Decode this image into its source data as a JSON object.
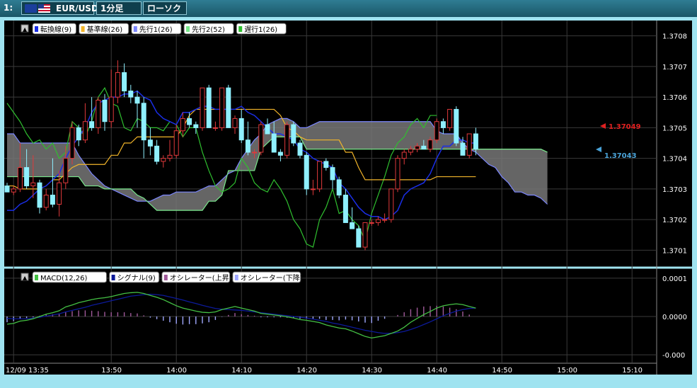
{
  "toolbar": {
    "pane_number": "1:",
    "pair": "EUR/USD",
    "timeframe": "1分足",
    "chart_type": "ローソク"
  },
  "colors": {
    "bg": "#000000",
    "grid": "#3a3a3a",
    "up_body": "#000000",
    "up_border": "#e0393b",
    "down_body": "#8ff0ff",
    "kumo": "#777777",
    "tenkan": "#1a2ee6",
    "kijun": "#f2b52a",
    "senkou1": "#7b86ff",
    "senkou2": "#79e88c",
    "chikou": "#2fbf2f",
    "macd": "#44c044",
    "signal": "#0c1a9a",
    "osc_up": "#a05a9a",
    "osc_down": "#a0a8ff"
  },
  "chart_data": [
    {
      "type": "candlestick",
      "legend": [
        "転換線(9)",
        "基準線(26)",
        "先行1(26)",
        "先行2(52)",
        "遅行1(26)"
      ],
      "y_ticks": [
        "1.3708",
        "1.3707",
        "1.3706",
        "1.3705",
        "1.3704",
        "1.3703",
        "1.3702",
        "1.3701"
      ],
      "ylim": [
        1.37005,
        1.37085
      ],
      "x_ticks": [
        "12/09 13:35",
        "13:50",
        "14:00",
        "14:10",
        "14:20",
        "14:30",
        "14:40",
        "14:50",
        "15:00",
        "15:10"
      ],
      "price_labels": [
        "1.37049",
        "1.37043"
      ],
      "candles": [
        [
          1.37031,
          1.37032,
          1.37029,
          1.37029
        ],
        [
          1.37029,
          1.37031,
          1.37028,
          1.3703
        ],
        [
          1.3703,
          1.37045,
          1.37029,
          1.37037
        ],
        [
          1.37037,
          1.37043,
          1.3703,
          1.37031
        ],
        [
          1.37031,
          1.37041,
          1.37027,
          1.37032
        ],
        [
          1.37032,
          1.37033,
          1.37022,
          1.37024
        ],
        [
          1.37024,
          1.3703,
          1.37023,
          1.37028
        ],
        [
          1.37028,
          1.3704,
          1.37024,
          1.37025
        ],
        [
          1.37025,
          1.37036,
          1.37021,
          1.37032
        ],
        [
          1.37032,
          1.37044,
          1.3703,
          1.3704
        ],
        [
          1.3704,
          1.37052,
          1.37038,
          1.3705
        ],
        [
          1.3705,
          1.37051,
          1.37044,
          1.37046
        ],
        [
          1.37046,
          1.37058,
          1.37045,
          1.37052
        ],
        [
          1.37052,
          1.3706,
          1.37049,
          1.3705
        ],
        [
          1.3705,
          1.3706,
          1.37048,
          1.37059
        ],
        [
          1.37059,
          1.37061,
          1.37049,
          1.37052
        ],
        [
          1.37052,
          1.37069,
          1.3705,
          1.3706
        ],
        [
          1.3706,
          1.37072,
          1.37058,
          1.37068
        ],
        [
          1.37068,
          1.37071,
          1.3706,
          1.37062
        ],
        [
          1.37062,
          1.37064,
          1.37058,
          1.3706
        ],
        [
          1.3706,
          1.37062,
          1.3705,
          1.37058
        ],
        [
          1.37058,
          1.3706,
          1.3704,
          1.37046
        ],
        [
          1.37046,
          1.3705,
          1.37041,
          1.37044
        ],
        [
          1.37044,
          1.37046,
          1.37038,
          1.37039
        ],
        [
          1.37039,
          1.37041,
          1.37037,
          1.3704
        ],
        [
          1.3704,
          1.37046,
          1.37039,
          1.37041
        ],
        [
          1.37041,
          1.37051,
          1.3704,
          1.37049
        ],
        [
          1.37049,
          1.37055,
          1.37047,
          1.37053
        ],
        [
          1.37053,
          1.37055,
          1.3705,
          1.37051
        ],
        [
          1.37051,
          1.37052,
          1.37048,
          1.3705
        ],
        [
          1.3705,
          1.37063,
          1.37049,
          1.37063
        ],
        [
          1.37063,
          1.37064,
          1.3705,
          1.3705
        ],
        [
          1.3705,
          1.37052,
          1.37049,
          1.3705
        ],
        [
          1.3705,
          1.37063,
          1.37049,
          1.37063
        ],
        [
          1.37063,
          1.37064,
          1.3705,
          1.3705
        ],
        [
          1.3705,
          1.37054,
          1.37048,
          1.37053
        ],
        [
          1.37053,
          1.37056,
          1.37045,
          1.37046
        ],
        [
          1.37046,
          1.37052,
          1.37041,
          1.37042
        ],
        [
          1.37042,
          1.37043,
          1.3704,
          1.37042
        ],
        [
          1.37042,
          1.37052,
          1.37041,
          1.37051
        ],
        [
          1.37051,
          1.37053,
          1.37048,
          1.37048
        ],
        [
          1.37048,
          1.37052,
          1.37043,
          1.37042
        ],
        [
          1.37042,
          1.37043,
          1.37039,
          1.37041
        ],
        [
          1.37041,
          1.37052,
          1.3704,
          1.37051
        ],
        [
          1.37051,
          1.37052,
          1.37044,
          1.37045
        ],
        [
          1.37045,
          1.37046,
          1.3704,
          1.37041
        ],
        [
          1.37041,
          1.37042,
          1.37028,
          1.3703
        ],
        [
          1.3703,
          1.37033,
          1.37028,
          1.3703
        ],
        [
          1.3703,
          1.37039,
          1.37029,
          1.37039
        ],
        [
          1.37039,
          1.3704,
          1.37036,
          1.37037
        ],
        [
          1.37037,
          1.37038,
          1.3703,
          1.37033
        ],
        [
          1.37033,
          1.37034,
          1.37027,
          1.37028
        ],
        [
          1.37028,
          1.3703,
          1.37019,
          1.37019
        ],
        [
          1.37019,
          1.37024,
          1.37017,
          1.37017
        ],
        [
          1.37017,
          1.37018,
          1.37011,
          1.37011
        ],
        [
          1.37011,
          1.37019,
          1.3701,
          1.37019
        ],
        [
          1.37019,
          1.3702,
          1.37018,
          1.37019
        ],
        [
          1.37019,
          1.37021,
          1.37018,
          1.3702
        ],
        [
          1.3702,
          1.37022,
          1.37019,
          1.3702
        ],
        [
          1.3702,
          1.3703,
          1.37019,
          1.3703
        ],
        [
          1.3703,
          1.37041,
          1.37029,
          1.3704
        ],
        [
          1.3704,
          1.37043,
          1.37038,
          1.37042
        ],
        [
          1.37042,
          1.37044,
          1.37041,
          1.37043
        ],
        [
          1.37043,
          1.37045,
          1.37042,
          1.37044
        ],
        [
          1.37044,
          1.37046,
          1.37043,
          1.37043
        ],
        [
          1.37043,
          1.37047,
          1.37042,
          1.37046
        ],
        [
          1.37046,
          1.37053,
          1.37045,
          1.37052
        ],
        [
          1.37052,
          1.37053,
          1.37048,
          1.3705
        ],
        [
          1.3705,
          1.37056,
          1.37049,
          1.37056
        ],
        [
          1.37056,
          1.37057,
          1.37044,
          1.37045
        ],
        [
          1.37045,
          1.37047,
          1.37041,
          1.37041
        ],
        [
          1.37041,
          1.37048,
          1.3704,
          1.37048
        ],
        [
          1.37048,
          1.3705,
          1.37041,
          1.37043
        ]
      ],
      "tenkan": [
        1.37023,
        1.37023,
        1.37025,
        1.37026,
        1.37028,
        1.3703,
        1.37031,
        1.37033,
        1.37035,
        1.3704,
        1.37044,
        1.37047,
        1.3705,
        1.37055,
        1.37058,
        1.37059,
        1.3706,
        1.3706,
        1.37061,
        1.37061,
        1.37062,
        1.3706,
        1.37059,
        1.37055,
        1.37053,
        1.37052,
        1.37051,
        1.37055,
        1.37055,
        1.37056,
        1.37057,
        1.37057,
        1.37056,
        1.37056,
        1.37056,
        1.37056,
        1.37057,
        1.37055,
        1.37054,
        1.37052,
        1.3705,
        1.37048,
        1.37048,
        1.37047,
        1.37046,
        1.37043,
        1.37042,
        1.3704,
        1.37039,
        1.37038,
        1.37037,
        1.37032,
        1.3703,
        1.37027,
        1.37024,
        1.37022,
        1.37021,
        1.37021,
        1.3702,
        1.37021,
        1.37023,
        1.37028,
        1.3703,
        1.37031,
        1.37032,
        1.37035,
        1.3704,
        1.37044,
        1.37044,
        1.37046,
        1.37046,
        1.37045,
        1.37045
      ],
      "kijun": [
        1.37031,
        1.37031,
        1.3703,
        1.3703,
        1.3703,
        1.3703,
        1.37031,
        1.37033,
        1.37033,
        1.37035,
        1.37037,
        1.37038,
        1.37038,
        1.37038,
        1.37038,
        1.37038,
        1.37041,
        1.37041,
        1.37045,
        1.37045,
        1.37047,
        1.37047,
        1.37047,
        1.37047,
        1.37047,
        1.37047,
        1.37047,
        1.3705,
        1.37054,
        1.37056,
        1.37056,
        1.37056,
        1.37056,
        1.37056,
        1.37056,
        1.37056,
        1.37056,
        1.37056,
        1.37056,
        1.37056,
        1.37056,
        1.37056,
        1.37054,
        1.3705,
        1.37049,
        1.37047,
        1.37046,
        1.37046,
        1.37046,
        1.37046,
        1.37046,
        1.37046,
        1.37042,
        1.37042,
        1.37037,
        1.37033,
        1.37033,
        1.37033,
        1.37033,
        1.37033,
        1.37033,
        1.37033,
        1.37033,
        1.37033,
        1.37033,
        1.37033,
        1.37034,
        1.37034,
        1.37034,
        1.37034,
        1.37034,
        1.37034,
        1.37034
      ],
      "senkou1": [
        1.37048,
        1.37048,
        1.37045,
        1.37045,
        1.37045,
        1.37045,
        1.37045,
        1.37045,
        1.37045,
        1.37045,
        1.37045,
        1.37041,
        1.37038,
        1.37035,
        1.37033,
        1.37031,
        1.3703,
        1.37029,
        1.37028,
        1.37027,
        1.37026,
        1.37026,
        1.37026,
        1.37027,
        1.37028,
        1.37028,
        1.37029,
        1.37029,
        1.37029,
        1.37029,
        1.3703,
        1.37031,
        1.37031,
        1.37033,
        1.37035,
        1.37036,
        1.3704,
        1.37043,
        1.37046,
        1.37048,
        1.37051,
        1.37052,
        1.37053,
        1.37053,
        1.37052,
        1.3705,
        1.3705,
        1.37051,
        1.37052,
        1.37052,
        1.37052,
        1.37052,
        1.37052,
        1.37052,
        1.37052,
        1.37052,
        1.37052,
        1.37052,
        1.37052,
        1.37052,
        1.37052,
        1.37052,
        1.37052,
        1.37052,
        1.37052,
        1.37052,
        1.37049,
        1.37048,
        1.37048,
        1.37048,
        1.37045,
        1.37043,
        1.37042,
        1.3704,
        1.37038,
        1.37037,
        1.37034,
        1.37032,
        1.37029,
        1.37029,
        1.37028,
        1.37028,
        1.37027,
        1.37025
      ],
      "senkou2": [
        1.37034,
        1.37034,
        1.37034,
        1.37034,
        1.37034,
        1.37034,
        1.37034,
        1.37034,
        1.37034,
        1.37034,
        1.37034,
        1.37034,
        1.37031,
        1.37031,
        1.37031,
        1.3703,
        1.3703,
        1.3703,
        1.3703,
        1.3703,
        1.37028,
        1.37027,
        1.37025,
        1.37023,
        1.37023,
        1.37023,
        1.37023,
        1.37023,
        1.37023,
        1.37023,
        1.37023,
        1.37026,
        1.37026,
        1.37028,
        1.37036,
        1.37036,
        1.37036,
        1.37036,
        1.37036,
        1.37043,
        1.37045,
        1.37047,
        1.37047,
        1.37047,
        1.37047,
        1.37047,
        1.37043,
        1.37043,
        1.37043,
        1.37043,
        1.37043,
        1.37043,
        1.37043,
        1.37043,
        1.37043,
        1.37043,
        1.37043,
        1.37043,
        1.37043,
        1.37043,
        1.37043,
        1.37043,
        1.37043,
        1.37043,
        1.37043,
        1.37043,
        1.37043,
        1.37043,
        1.37043,
        1.37043,
        1.37043,
        1.37043,
        1.37043,
        1.37043,
        1.37043,
        1.37043,
        1.37043,
        1.37043,
        1.37043,
        1.37043,
        1.37043,
        1.37043,
        1.37043,
        1.37042
      ],
      "chikou": [
        1.37058,
        1.37055,
        1.37052,
        1.37048,
        1.37045,
        1.37046,
        1.37043,
        1.37045,
        1.3704,
        1.37042,
        1.37052,
        1.3705,
        1.37047,
        1.37052,
        1.3706,
        1.37063,
        1.37058,
        1.37057,
        1.3705,
        1.37049,
        1.37053,
        1.37052,
        1.3705,
        1.3705,
        1.37049,
        1.37052,
        1.37051,
        1.37047,
        1.3705,
        1.3705,
        1.37042,
        1.37036,
        1.37031,
        1.37029,
        1.3703,
        1.37032,
        1.3704,
        1.37037,
        1.37032,
        1.3703,
        1.37029,
        1.37033,
        1.3703,
        1.37026,
        1.3702,
        1.37017,
        1.37012,
        1.37011,
        1.3702,
        1.37024,
        1.3703,
        1.37022,
        1.37023,
        1.3702,
        1.37018,
        1.37013,
        1.37022,
        1.37028,
        1.37034,
        1.37041,
        1.37045,
        1.37047,
        1.37051,
        1.37053,
        1.3705,
        1.37054,
        1.37054
      ]
    },
    {
      "type": "macd",
      "legend": [
        "MACD(12,26)",
        "シグナル(9)",
        "オシレーター(上昇)",
        "オシレーター(下降)"
      ],
      "y_ticks": [
        "0.0001",
        "0.0000",
        "-0.000"
      ],
      "ylim": [
        -0.00012,
        0.00012
      ],
      "macd": [
        -2e-05,
        -1.8e-05,
        -1.2e-05,
        -1e-05,
        -6e-06,
        0,
        6e-06,
        1e-05,
        1.5e-05,
        2.5e-05,
        3e-05,
        3.6e-05,
        4e-05,
        4.4e-05,
        4.7e-05,
        4.9e-05,
        5.2e-05,
        5.6e-05,
        6e-05,
        6.2e-05,
        6.3e-05,
        6e-05,
        5.5e-05,
        5e-05,
        4.4e-05,
        3.6e-05,
        2.8e-05,
        2.2e-05,
        1.8e-05,
        1.4e-05,
        1.1e-05,
        1e-05,
        1.2e-05,
        1.8e-05,
        2.2e-05,
        2.6e-05,
        2.2e-05,
        1.8e-05,
        1.4e-05,
        8e-06,
        6e-06,
        4e-06,
        2e-06,
        -1e-06,
        -4e-06,
        -8e-06,
        -1e-05,
        -1.3e-05,
        -1.6e-05,
        -2.2e-05,
        -2.6e-05,
        -3e-05,
        -3.2e-05,
        -3.8e-05,
        -4.5e-05,
        -5.2e-05,
        -5.6e-05,
        -5.3e-05,
        -5e-05,
        -4.4e-05,
        -3.8e-05,
        -2.8e-05,
        -1.5e-05,
        -5e-06,
        5e-06,
        1.3e-05,
        2.2e-05,
        2.8e-05,
        3.1e-05,
        3.3e-05,
        3.1e-05,
        2.6e-05,
        2.2e-05
      ],
      "signal": [
        -5e-06,
        -6e-06,
        -6e-06,
        -6e-06,
        -4e-06,
        -2e-06,
        1e-06,
        4e-06,
        7e-06,
        1.2e-05,
        1.6e-05,
        2e-05,
        2.4e-05,
        2.9e-05,
        3.3e-05,
        3.7e-05,
        4.1e-05,
        4.5e-05,
        4.9e-05,
        5.3e-05,
        5.5e-05,
        5.7e-05,
        5.8e-05,
        5.7e-05,
        5.5e-05,
        5.1e-05,
        4.7e-05,
        4.3e-05,
        3.8e-05,
        3.4e-05,
        2.9e-05,
        2.5e-05,
        2.1e-05,
        1.9e-05,
        1.8e-05,
        1.7e-05,
        1.6e-05,
        1.4e-05,
        1.2e-05,
        1e-05,
        8e-06,
        6e-06,
        4e-06,
        2e-06,
        0,
        -2e-06,
        -4e-06,
        -7e-06,
        -1e-05,
        -1.3e-05,
        -1.7e-05,
        -2e-05,
        -2.4e-05,
        -2.8e-05,
        -3.2e-05,
        -3.6e-05,
        -3.9e-05,
        -4.2e-05,
        -4.4e-05,
        -4.4e-05,
        -4.2e-05,
        -3.9e-05,
        -3.4e-05,
        -2.8e-05,
        -2.1e-05,
        -1.4e-05,
        -6e-06,
        2e-06,
        8e-06,
        1.4e-05,
        1.8e-05,
        2.1e-05,
        2.2e-05
      ]
    }
  ]
}
